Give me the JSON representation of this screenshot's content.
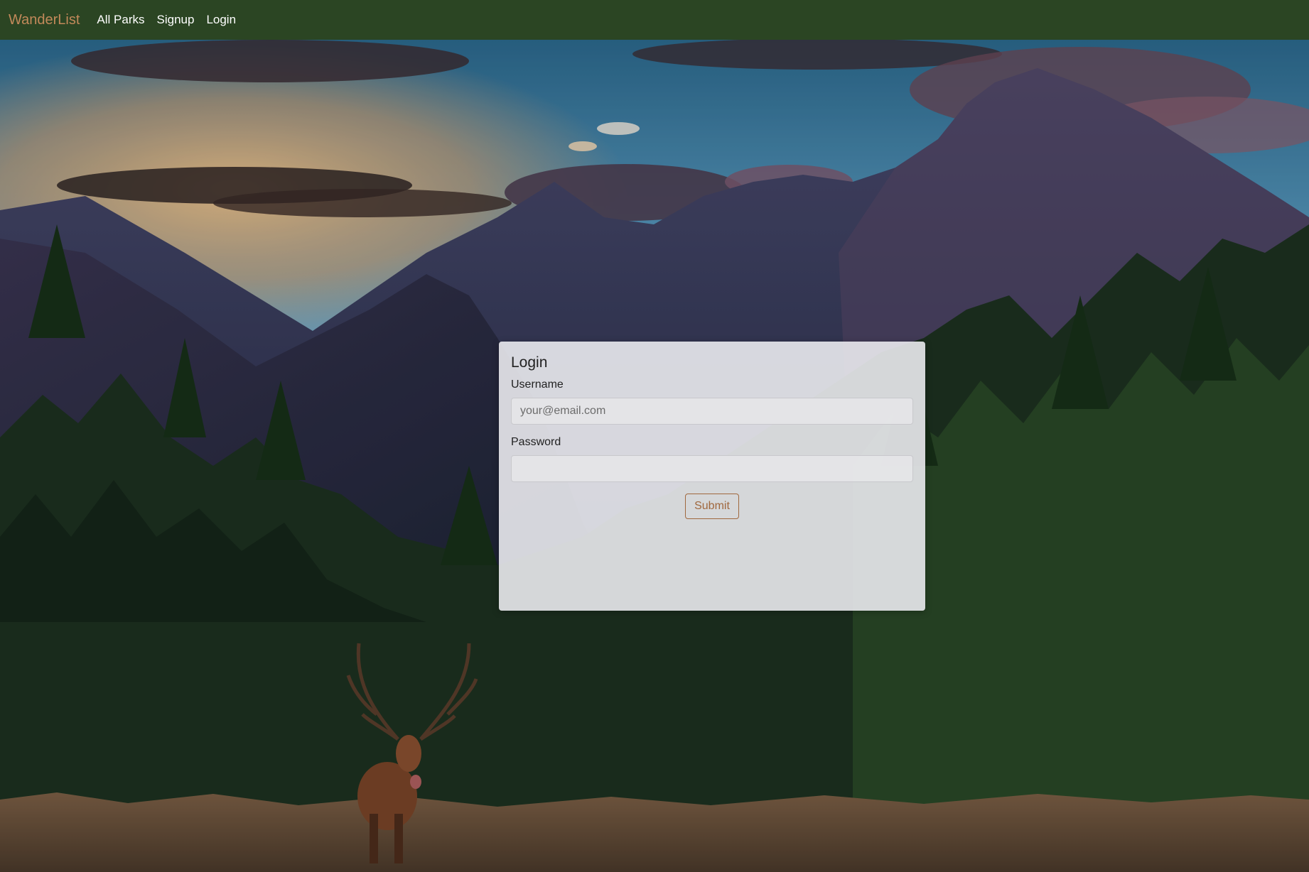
{
  "navbar": {
    "brand": "WanderList",
    "links": [
      {
        "label": "All Parks"
      },
      {
        "label": "Signup"
      },
      {
        "label": "Login"
      }
    ],
    "background_color": "#2b4523",
    "brand_color": "#c2895a"
  },
  "login_form": {
    "title": "Login",
    "username": {
      "label": "Username",
      "placeholder": "your@email.com",
      "value": ""
    },
    "password": {
      "label": "Password",
      "value": ""
    },
    "submit_label": "Submit",
    "accent_color": "#a0683e"
  }
}
